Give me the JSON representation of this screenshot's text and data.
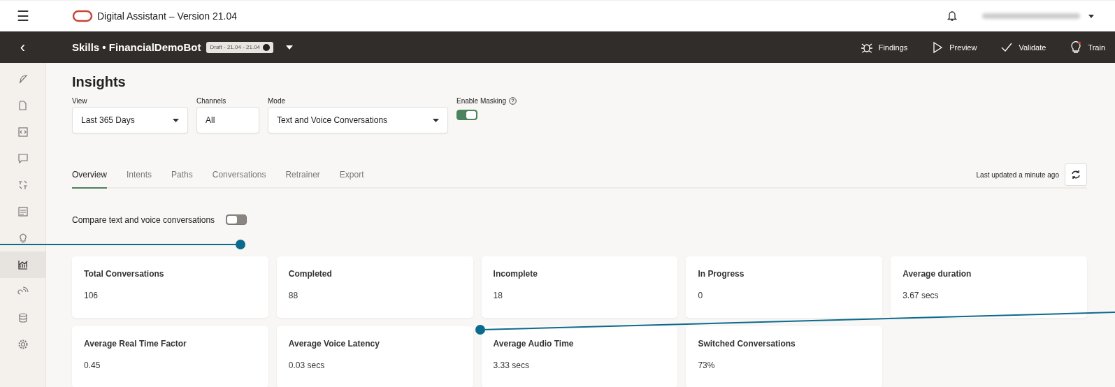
{
  "header": {
    "menu_glyph": "☰",
    "title": "Digital Assistant – Version 21.04"
  },
  "skill_bar": {
    "back_glyph": "‹",
    "title": "Skills • FinancialDemoBot",
    "badge": "Draft - 21.04 - 21.04",
    "actions": [
      {
        "label": "Findings"
      },
      {
        "label": "Preview"
      },
      {
        "label": "Validate"
      },
      {
        "label": "Train"
      }
    ]
  },
  "sidebar": {
    "items": [
      {
        "selected": false
      },
      {
        "selected": false
      },
      {
        "selected": false
      },
      {
        "selected": false
      },
      {
        "selected": false
      },
      {
        "selected": false
      },
      {
        "selected": false
      },
      {
        "selected": true
      },
      {
        "selected": false
      },
      {
        "selected": false
      },
      {
        "selected": false
      }
    ]
  },
  "page": {
    "title": "Insights",
    "filters": [
      {
        "kind": "select",
        "label": "View",
        "value": "Last 365 Days"
      },
      {
        "kind": "text",
        "label": "Channels",
        "value": "All"
      },
      {
        "kind": "select",
        "label": "Mode",
        "value": "Text and Voice Conversations"
      },
      {
        "kind": "toggle",
        "label": "Enable Masking",
        "on": true
      }
    ],
    "tabs": [
      {
        "label": "Overview",
        "selected": true
      },
      {
        "label": "Intents",
        "selected": false
      },
      {
        "label": "Paths",
        "selected": false
      },
      {
        "label": "Conversations",
        "selected": false
      },
      {
        "label": "Retrainer",
        "selected": false
      },
      {
        "label": "Export",
        "selected": false
      }
    ],
    "last_updated": "Last updated a minute ago",
    "compare": {
      "label": "Compare text and voice conversations",
      "on": false
    },
    "metrics": [
      {
        "label": "Total Conversations",
        "value": "106"
      },
      {
        "label": "Completed",
        "value": "88"
      },
      {
        "label": "Incomplete",
        "value": "18"
      },
      {
        "label": "In Progress",
        "value": "0"
      },
      {
        "label": "Average duration",
        "value": "3.67 secs"
      },
      {
        "label": "Average Real Time Factor",
        "value": "0.45"
      },
      {
        "label": "Average Voice Latency",
        "value": "0.03 secs"
      },
      {
        "label": "Average Audio Time",
        "value": "3.33 secs"
      },
      {
        "label": "Switched Conversations",
        "value": "73%"
      }
    ]
  }
}
